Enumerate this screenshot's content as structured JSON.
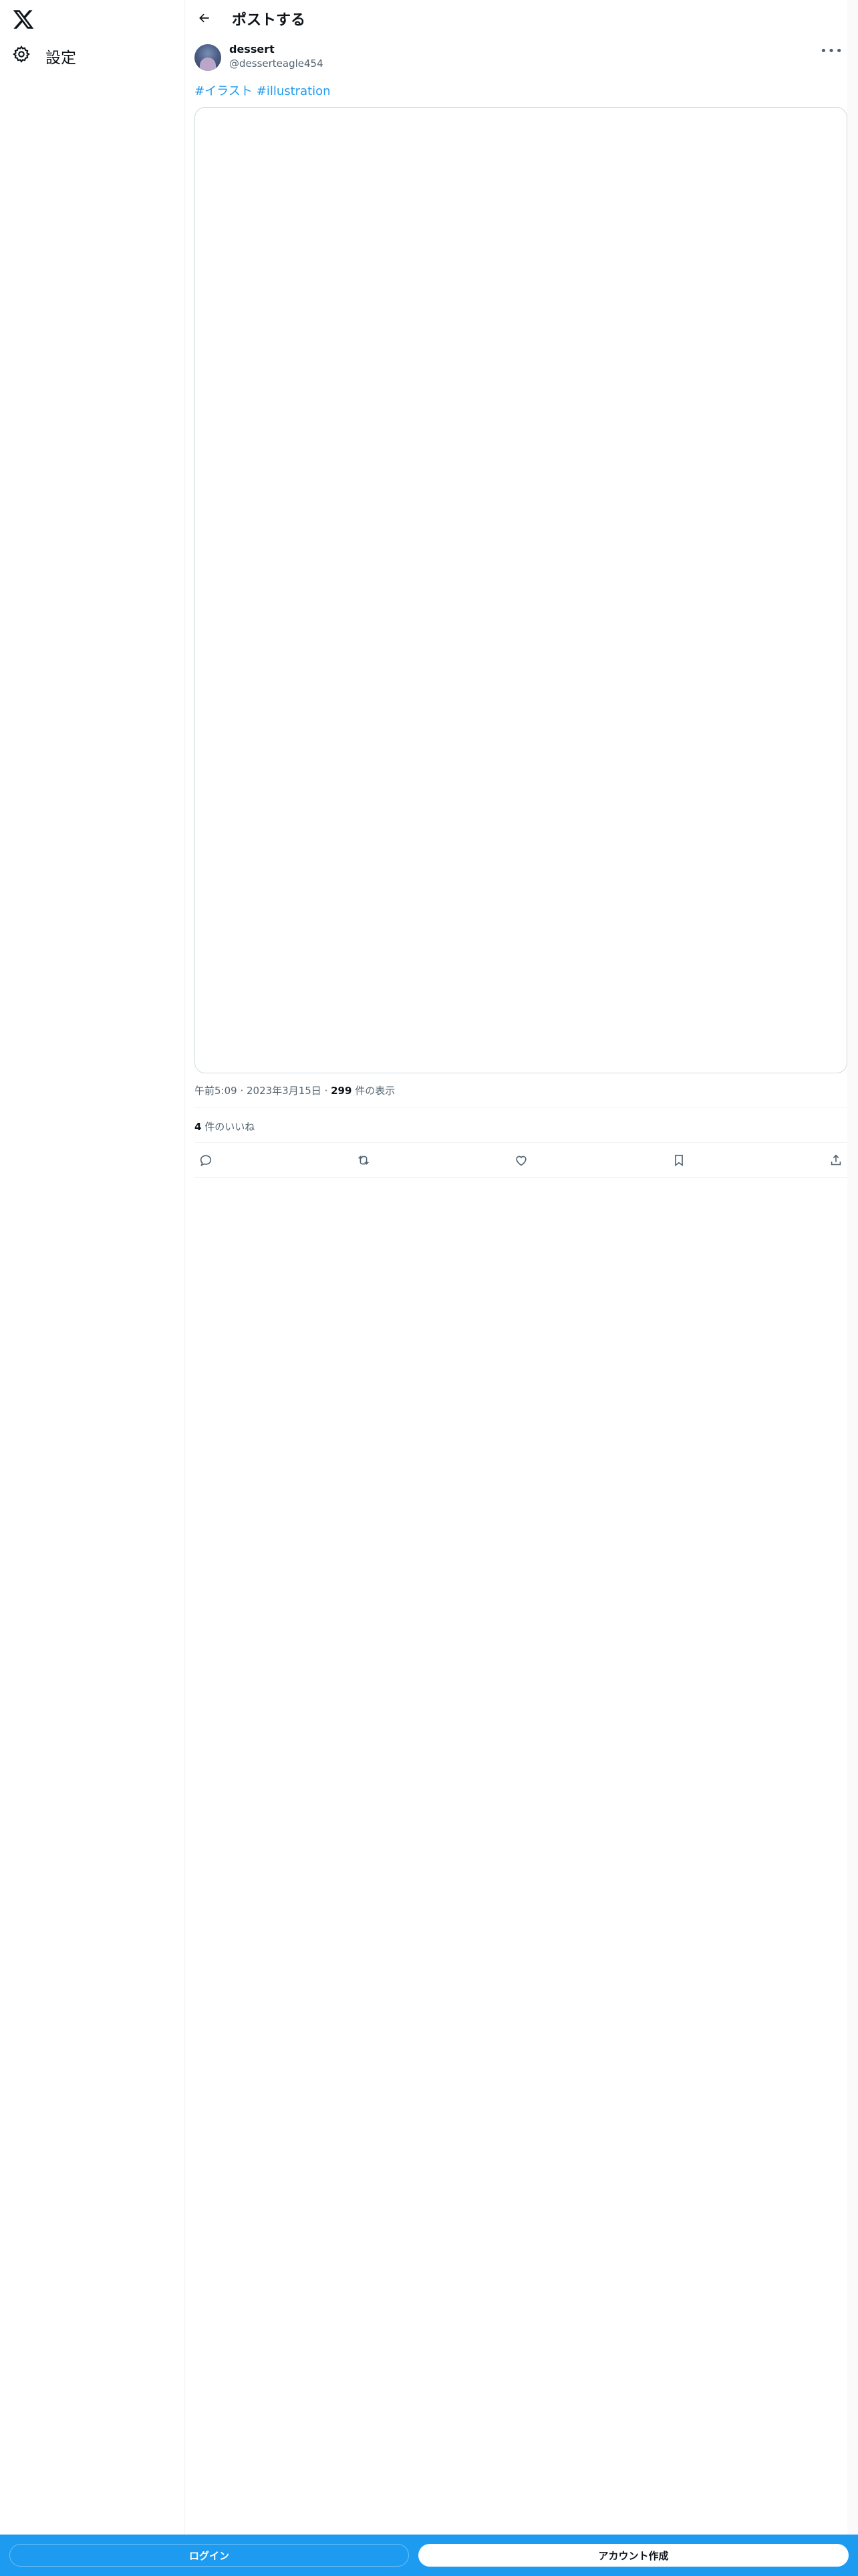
{
  "sidebar": {
    "logo_icon": "x-logo-icon",
    "settings_label": "設定",
    "settings_icon": "gear-icon"
  },
  "header": {
    "title": "ポストする",
    "back_icon": "arrow-left-icon"
  },
  "post": {
    "author_name": "dessert",
    "author_handle": "@desserteagle454",
    "more_icon": "more-icon",
    "hashtags": [
      "#イラスト",
      "#illustration"
    ],
    "time": "午前5:09",
    "date": "2023年3月15日",
    "views_count": "299",
    "views_label": "件の表示",
    "likes_count": "4",
    "likes_label": "件のいいね",
    "actions": [
      "reply-icon",
      "repost-icon",
      "like-icon",
      "bookmark-icon",
      "share-icon"
    ]
  },
  "bottom": {
    "login_label": "ログイン",
    "signup_label": "アカウント作成"
  },
  "colors": {
    "accent": "#1d9bf0",
    "text_primary": "#0f1419",
    "text_secondary": "#536471",
    "border": "#cfd9de"
  }
}
